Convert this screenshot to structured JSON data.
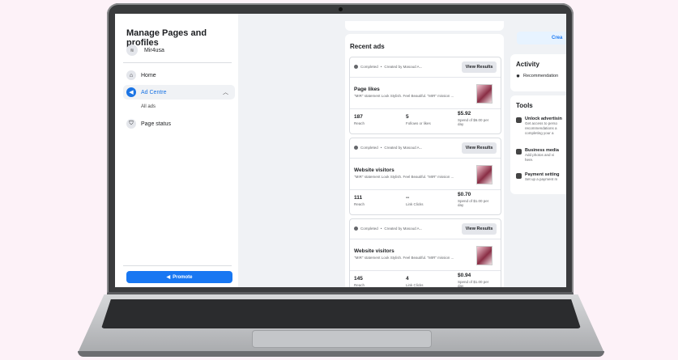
{
  "sidebar": {
    "title": "Manage Pages and profiles",
    "profile_name": "Mir4usa",
    "nav": [
      {
        "label": "Home",
        "icon": "home-icon"
      },
      {
        "label": "Ad Centre",
        "icon": "megaphone-icon"
      },
      {
        "label": "Page status",
        "icon": "shield-icon"
      }
    ],
    "sub_item": "All ads",
    "promote_label": "Promote"
  },
  "recent_ads": {
    "title": "Recent ads",
    "ads": [
      {
        "status": "Completed",
        "created_by": "Created by Masoud A...",
        "button": "View Results",
        "title": "Page likes",
        "description": "\"MIR\" statement Look Stylish. Feel Beautiful. \"MIR\" mission ...",
        "m1_value": "187",
        "m1_label": "Reach",
        "m2_value": "5",
        "m2_label": "Follows or likes",
        "m3_value": "$5.92",
        "m3_label": "Spend of $6.00 per day"
      },
      {
        "status": "Completed",
        "created_by": "Created by Masoud A...",
        "button": "View Results",
        "title": "Website visitors",
        "description": "\"MIR\" statement Look Stylish. Feel Beautiful. \"MIR\" mission ...",
        "m1_value": "111",
        "m1_label": "Reach",
        "m2_value": "--",
        "m2_label": "Link Clicks",
        "m3_value": "$0.70",
        "m3_label": "Spend of $1.00 per day"
      },
      {
        "status": "Completed",
        "created_by": "Created by Masoud A...",
        "button": "View Results",
        "title": "Website visitors",
        "description": "\"MIR\" statement Look Stylish. Feel Beautiful. \"MIR\" mission ...",
        "m1_value": "145",
        "m1_label": "Reach",
        "m2_value": "4",
        "m2_label": "Link Clicks",
        "m3_value": "$0.94",
        "m3_label": "Spend of $1.00 per day"
      }
    ]
  },
  "right_panel": {
    "create_button": "Crea",
    "activity_title": "Activity",
    "activity_item": "Recommendation",
    "tools_title": "Tools",
    "tools": [
      {
        "title": "Unlock advertisin",
        "desc": [
          "Get access to perso",
          "recommendations a",
          "completing your a"
        ]
      },
      {
        "title": "Business media",
        "desc": [
          "Add photos and vi",
          "here."
        ]
      },
      {
        "title": "Payment setting",
        "desc": [
          "Set up a payment m"
        ]
      }
    ]
  },
  "colors": {
    "accent": "#1877f2",
    "background": "#fdf2f8"
  }
}
